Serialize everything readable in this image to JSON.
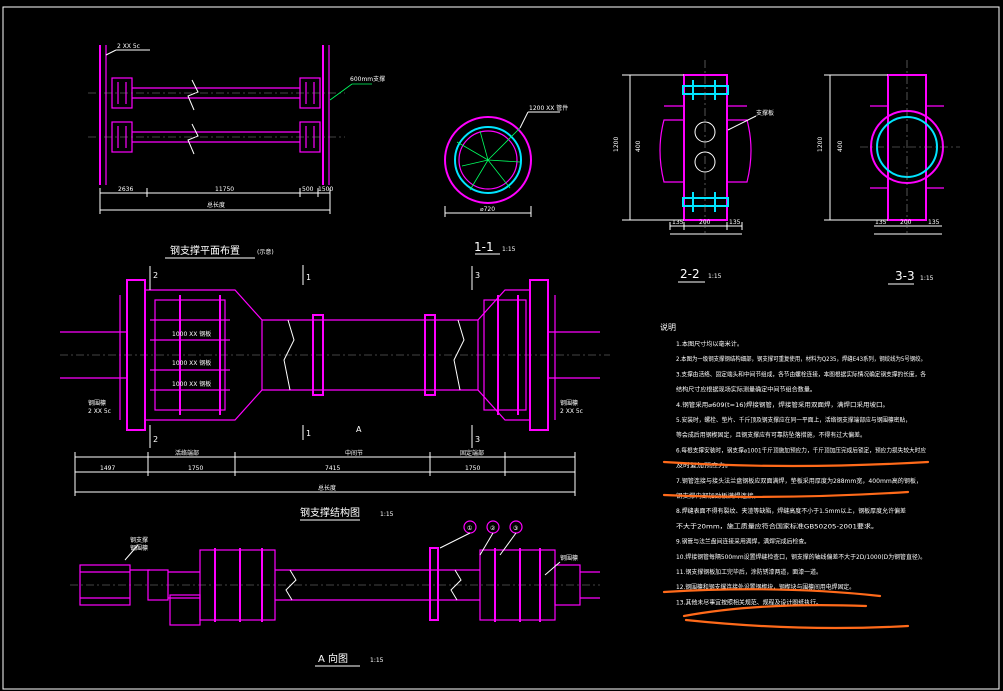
{
  "drawing": {
    "colors": {
      "background": "#000000",
      "steel": "#ff00ff",
      "pipe": "#00e5ff",
      "leader": "#00ff60",
      "text": "#ffffff",
      "markup": "#ff6a1a"
    },
    "plan_view": {
      "title": "钢支撑平面布置",
      "scale_note": "(示意)",
      "tag_top": "2 XX 5c",
      "tag_right": "600mm支撑",
      "dims": [
        "2636",
        "11750",
        "500",
        "1500"
      ],
      "total": "总长度"
    },
    "section_1": {
      "label": "1-1",
      "scale": "1:15",
      "tag": "1200 XX 管件",
      "dim": "⌀720"
    },
    "section_2": {
      "label": "2-2",
      "scale": "1:15",
      "note": "支撑板",
      "dims_side": [
        "1200",
        "400"
      ],
      "dims_bottom": [
        "135",
        "200",
        "135"
      ]
    },
    "section_3": {
      "label": "3-3",
      "scale": "1:15",
      "dims_side": [
        "1200",
        "400"
      ],
      "dims_bottom": [
        "135",
        "200",
        "135"
      ]
    },
    "structure_view": {
      "title": "钢支撑结构图",
      "scale": "1:15",
      "cut_marks": [
        "2",
        "3",
        "1",
        "1",
        "A"
      ],
      "labels": [
        "钢围檩",
        "2 XX 5c"
      ],
      "inner_labels": [
        "1000 XX 钢板",
        "1000 XX 钢板",
        "1000 XX 钢板"
      ],
      "dims": [
        "1497",
        "7415",
        "1750",
        "1750"
      ],
      "zone_labels": [
        "活络端部",
        "中间节",
        "固定端部"
      ],
      "total": "总长度"
    },
    "a_view": {
      "label": "A 向图",
      "scale": "1:15",
      "callouts": [
        "①",
        "②",
        "③"
      ],
      "tag_left": "钢支撑",
      "tag_left2": "钢围檩",
      "tag_right": "钢围檩"
    },
    "notes": {
      "heading": "说明",
      "items": [
        "1.本图尺寸均以毫米计。",
        "2.本图为一级钢支撑钢结构细部，钢支撑可重复使用，材料为Q235，焊缝E43系列，钢绞线为5号钢绞。",
        "3.支撑由活络、固定端头和中间节组成，各节由螺栓连接，本图根据实际情况确定钢支撑的长度，各",
        "  结构尺寸应根据现场实际测量确定中间节组合数量。",
        "4.钢管采用⌀609(t=16)焊接钢管，焊接管采用双面焊，满焊口采用坡口。",
        "5.安装时，螺栓、垫片、千斤顶及钢支撑应在同一平面上，活络钢支撑端部应与钢围檩密贴，",
        "  等会成后用钢楔固定，且钢支撑应有可靠防坠落措施，不得有过大偏差。",
        "6.每根支撑安装时，钢支撑⌀1001千斤顶施加预应力，千斤顶加压完成后锁定，预应力损失较大时应",
        "  及时复加预应力。",
        "7.钢管连接与接头法兰盘钢板应双面满焊，垫板采用厚度为288mm宽，400mm高的钢板，",
        "  钢支撑内部加劲板满焊连接。",
        "8.焊缝表面不得有裂纹、夹渣等缺陷，焊缝高度不小于1.5mm以上，钢板厚度允许偏差",
        "  不大于20mm，施工质量应符合国家标准GB50205-2001要求。",
        "9.钢管与法兰盘间连接采用满焊，满焊完成后检查。",
        "10.焊接钢管每隔500mm设置焊缝检查口，钢支撑的轴线偏差不大于2D/1000(D为钢管直径)。",
        "11.钢支撑钢板加工完毕后，涂防锈漆两道，面漆一道。",
        "12.钢围檩和钢支撑连接处设置钢楔块，钢楔块与围檩间用电焊固定。",
        "13.其他未尽事宜按照相关规范、规程及设计图纸执行。"
      ]
    }
  }
}
